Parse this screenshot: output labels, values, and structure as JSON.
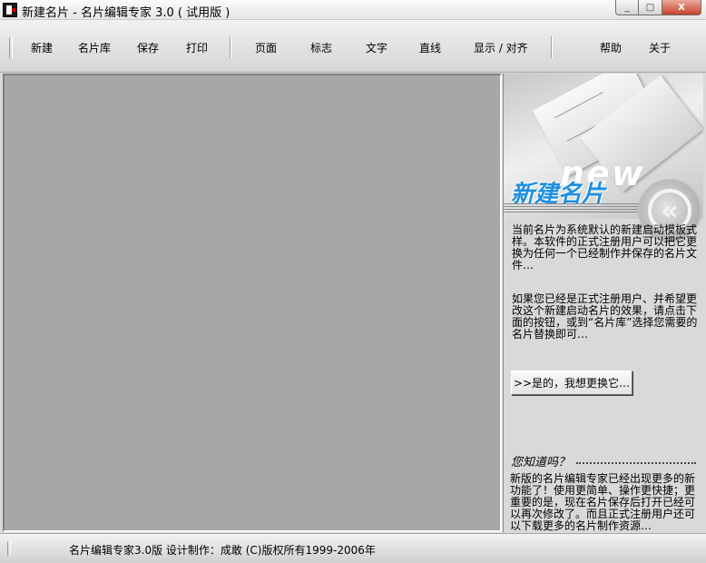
{
  "window": {
    "title": "新建名片 - 名片编辑专家 3.0 ( 试用版 )",
    "minimize_glyph": "_",
    "maximize_glyph": "□",
    "close_glyph": "X"
  },
  "toolbar": {
    "new": "新建",
    "library": "名片库",
    "save": "保存",
    "print": "打印",
    "page": "页面",
    "logo": "标志",
    "text": "文字",
    "line": "直线",
    "display_align": "显示 / 对齐",
    "help": "帮助",
    "about": "关于"
  },
  "panel": {
    "banner_word": "new",
    "banner_title": "新建名片",
    "nav_glyph": "«",
    "info1": "当前名片为系统默认的新建启动模板式样。本软件的正式注册用户可以把它更换为任何一个已经制作并保存的名片文件…",
    "info2": "如果您已经是正式注册用户、并希望更改这个新建启动名片的效果，请点击下面的按钮，或到“名片库”选择您需要的名片替换即可…",
    "replace_button": ">>是的，我想更换它…",
    "did_you_know": "您知道吗？",
    "tip": "新版的名片编辑专家已经出现更多的新功能了！使用更简单、操作更快捷；更重要的是，现在名片保存后打开已经可以再次修改了。而且正式注册用户还可以下载更多的名片制作资源…"
  },
  "status": {
    "text": "名片编辑专家3.0版    设计制作：成敢    (C)版权所有1999-2006年"
  },
  "icons": [
    "app-icon",
    "minimize-icon",
    "maximize-icon",
    "close-icon",
    "back-arrow-icon"
  ],
  "colors": {
    "workspace": "#a7a7a7",
    "accent_blue": "#1e8fe0",
    "close_red": "#c7432c"
  }
}
